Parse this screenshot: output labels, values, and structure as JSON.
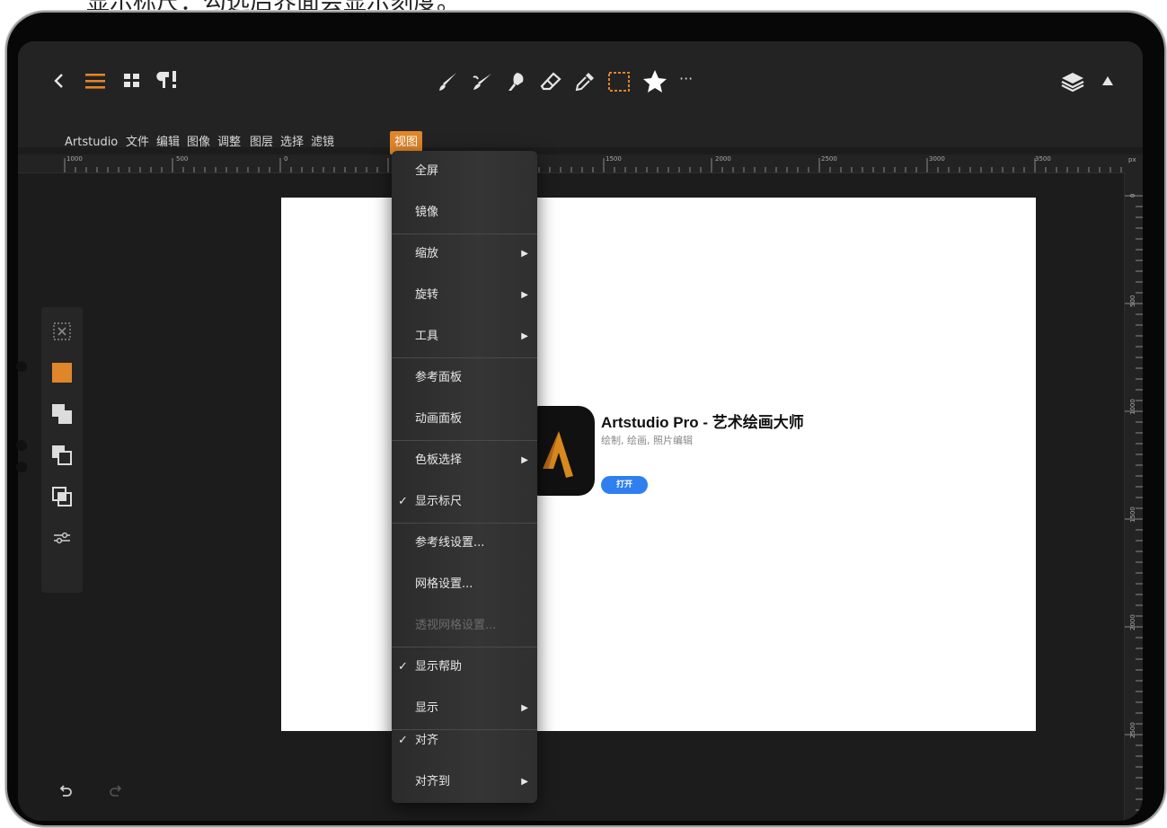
{
  "caption": "显示标尺：勾选后界面会显示刻度。",
  "toolbar": {
    "left_icons": [
      "back-icon",
      "menu-icon",
      "grid-icon",
      "brush-settings-icon"
    ],
    "center_icons": [
      "brush-icon",
      "smudge-icon",
      "blend-icon",
      "eraser-icon",
      "eyedropper-icon",
      "selection-icon",
      "favorites-icon",
      "more-icon"
    ],
    "more_label": "···",
    "right_icons": [
      "layers-icon",
      "collapse-icon"
    ]
  },
  "menu_bar": {
    "items": [
      "Artstudio",
      "文件",
      "编辑",
      "图像",
      "调整",
      "图层",
      "选择",
      "滤镜",
      "视图"
    ],
    "active": "视图"
  },
  "ruler_top": {
    "labels": [
      "1000",
      "500",
      "0",
      "1500",
      "2000",
      "2500",
      "3000",
      "3500"
    ],
    "unit": "px"
  },
  "ruler_right": {
    "labels": [
      "0",
      "500",
      "1000",
      "1500",
      "2000",
      "2500"
    ]
  },
  "view_menu": {
    "items": [
      {
        "label": "全屏",
        "check": "",
        "submenu": false,
        "disabled": false
      },
      {
        "label": "镜像",
        "check": "",
        "submenu": false,
        "disabled": false
      },
      {
        "label": "缩放",
        "check": "",
        "submenu": true,
        "disabled": false
      },
      {
        "label": "旋转",
        "check": "",
        "submenu": true,
        "disabled": false
      },
      {
        "label": "工具",
        "check": "",
        "submenu": true,
        "disabled": false
      },
      {
        "label": "参考面板",
        "check": "",
        "submenu": false,
        "disabled": false
      },
      {
        "label": "动画面板",
        "check": "",
        "submenu": false,
        "disabled": false
      },
      {
        "label": "色板选择",
        "check": "",
        "submenu": true,
        "disabled": false
      },
      {
        "label": "显示标尺",
        "check": "✓",
        "submenu": false,
        "disabled": false
      },
      {
        "label": "参考线设置...",
        "check": "",
        "submenu": false,
        "disabled": false
      },
      {
        "label": "网格设置...",
        "check": "",
        "submenu": false,
        "disabled": false
      },
      {
        "label": "透视网格设置...",
        "check": "",
        "submenu": false,
        "disabled": true
      },
      {
        "label": "显示帮助",
        "check": "✓",
        "submenu": false,
        "disabled": false
      },
      {
        "label": "显示",
        "check": "",
        "submenu": true,
        "disabled": false
      },
      {
        "label": "对齐",
        "check": "✓",
        "submenu": false,
        "disabled": false
      },
      {
        "label": "对齐到",
        "check": "",
        "submenu": true,
        "disabled": false
      }
    ],
    "arrow": "▶"
  },
  "canvas_content": {
    "app_title": "Artstudio Pro - 艺术绘画大师",
    "app_subtitle": "绘制, 绘画, 照片编辑",
    "open_button": "打开"
  },
  "colors": {
    "accent": "#e0862a",
    "button_blue": "#2f7ff0",
    "background": "#1c1c1c"
  },
  "side_tools": [
    "selection-mask-icon",
    "primary-color-swatch",
    "layer-merge-icon",
    "layer-below-icon",
    "layer-copy-icon",
    "adjust-sliders-icon"
  ],
  "history": [
    "undo-icon",
    "redo-icon"
  ]
}
